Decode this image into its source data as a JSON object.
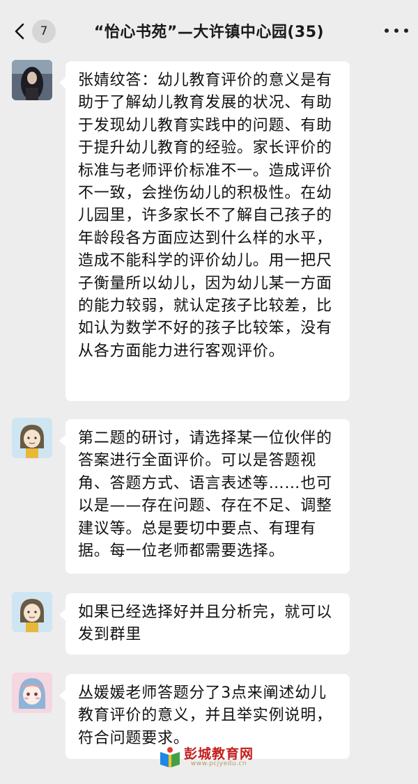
{
  "header": {
    "unread_count": "7",
    "title": "“怡心书苑”—大许镇中心园(35)",
    "back_icon": "chevron-left-icon",
    "more_icon": "more-dots-icon"
  },
  "messages": [
    {
      "avatar": "dark-hair-girl-avatar",
      "text": "张婧纹答：幼儿教育评价的意义是有助于了解幼儿教育发展的状况、有助于发现幼儿教育实践中的问题、有助于提升幼儿教育的经验。家长评价的标准与老师评价标准不一。造成评价不一致，会挫伤幼儿的积极性。在幼儿园里，许多家长不了解自己孩子的年龄段各方面应达到什么样的水平，造成不能科学的评价幼儿。用一把尺子衡量所以幼儿，因为幼儿某一方面的能力较弱，就认定孩子比较差，比如认为数学不好的孩子比较笨，没有从各方面能力进行客观评价。"
    },
    {
      "avatar": "cartoon-girl-avatar",
      "text": "第二题的研讨，请选择某一位伙伴的答案进行全面评价。可以是答题视角、答题方式、语言表述等……也可以是——存在问题、存在不足、调整建议等。总是要切中要点、有理有据。每一位老师都需要选择。"
    },
    {
      "avatar": "cartoon-girl-avatar",
      "text": "如果已经选择好并且分析完，就可以发到群里"
    },
    {
      "avatar": "blue-hood-girl-avatar",
      "text": "丛媛媛老师答题分了3点来阐述幼儿教育评价的意义，并且举实例说明，符合问题要求。"
    }
  ],
  "watermark": {
    "name": "彭城教育网",
    "url": "www.pcjyedu.cn"
  },
  "colors": {
    "background": "#ededed",
    "bubble": "#ffffff",
    "watermark_red": "#c41c1c"
  }
}
